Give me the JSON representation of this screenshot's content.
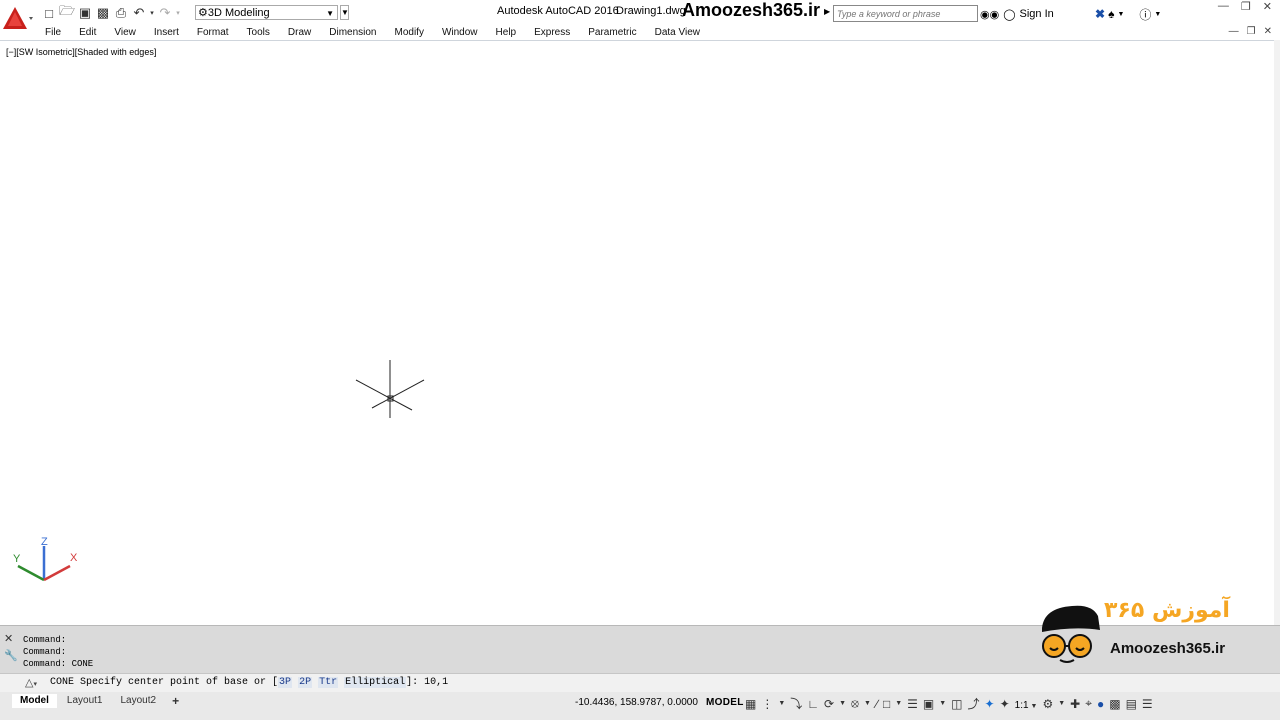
{
  "window": {
    "app_title": "Autodesk AutoCAD 2016",
    "document": "Drawing1.dwg",
    "brand": "Amoozesh365.ir"
  },
  "workspace": {
    "selected": "3D Modeling"
  },
  "search": {
    "placeholder": "Type a keyword or phrase"
  },
  "account": {
    "sign_in_label": "Sign In"
  },
  "menu": {
    "items": [
      "File",
      "Edit",
      "View",
      "Insert",
      "Format",
      "Tools",
      "Draw",
      "Dimension",
      "Modify",
      "Window",
      "Help",
      "Express",
      "Parametric",
      "Data View"
    ]
  },
  "viewport": {
    "label": "[−][SW Isometric][Shaded with edges]"
  },
  "ucs": {
    "x": "X",
    "y": "Y",
    "z": "Z"
  },
  "command": {
    "history": [
      "Command:",
      "Command:",
      "Command: CONE"
    ],
    "prompt_prefix": "CONE Specify center point of base or [",
    "options": [
      "3P",
      "2P",
      "Ttr",
      "Elliptical"
    ],
    "prompt_suffix": "]: ",
    "input": "10,1"
  },
  "layout_tabs": [
    "Model",
    "Layout1",
    "Layout2",
    "+"
  ],
  "status": {
    "coordinates": "-10.4436, 158.9787, 0.0000",
    "space": "MODEL",
    "scale": "1:1"
  },
  "watermark": {
    "text": "Amoozesh365.ir",
    "fa_text": "آموزش ۳۶۵"
  },
  "colors": {
    "logo_red": "#c8201b",
    "axis_x": "#d23b3b",
    "axis_y": "#2e8b2e",
    "axis_z": "#3b6fd2",
    "watermark_yellow": "#f5a623"
  }
}
